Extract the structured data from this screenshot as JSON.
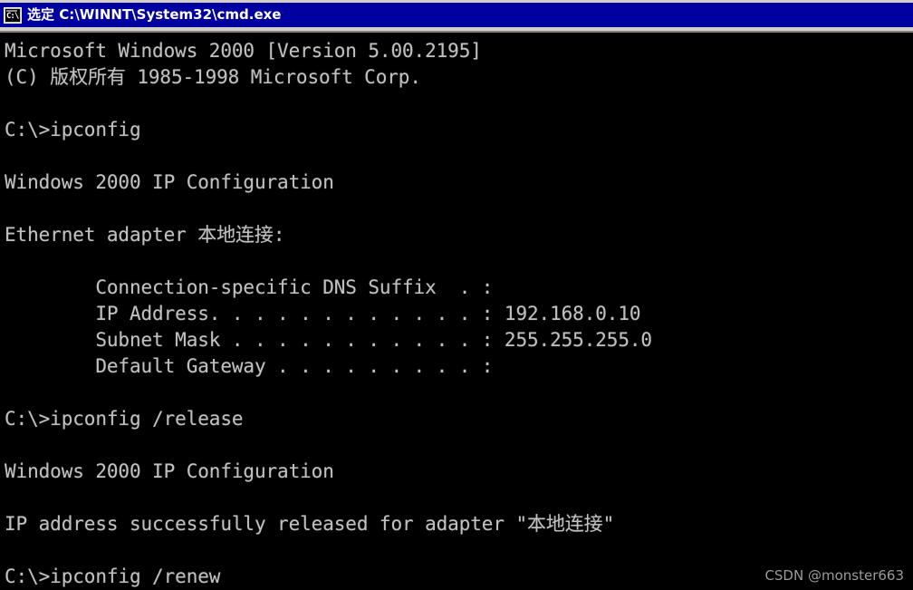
{
  "window": {
    "title_prefix": "选定",
    "title_path": "C:\\WINNT\\System32\\cmd.exe",
    "title_full": "选定 C:\\WINNT\\System32\\cmd.exe",
    "icon": "console-icon",
    "icon_glyph": "C:\\",
    "colors": {
      "titlebar_bg": "#0000a0",
      "titlebar_text": "#ffffff",
      "console_bg": "#000000",
      "console_text": "#c0c0c0",
      "frame": "#d4d0c8",
      "watermark_text": "#9a9a9a"
    }
  },
  "console": {
    "lines": [
      "Microsoft Windows 2000 [Version 5.00.2195]",
      "(C) 版权所有 1985-1998 Microsoft Corp.",
      "",
      "C:\\>ipconfig",
      "",
      "Windows 2000 IP Configuration",
      "",
      "Ethernet adapter 本地连接:",
      "",
      "        Connection-specific DNS Suffix  . :",
      "        IP Address. . . . . . . . . . . . : 192.168.0.10",
      "        Subnet Mask . . . . . . . . . . . : 255.255.255.0",
      "        Default Gateway . . . . . . . . . :",
      "",
      "C:\\>ipconfig /release",
      "",
      "Windows 2000 IP Configuration",
      "",
      "IP address successfully released for adapter \"本地连接\"",
      "",
      "C:\\>ipconfig /renew"
    ],
    "details": {
      "dns_suffix_label": "Connection-specific DNS Suffix",
      "dns_suffix_value": "",
      "ip_address_label": "IP Address",
      "ip_address_value": "192.168.0.10",
      "subnet_mask_label": "Subnet Mask",
      "subnet_mask_value": "255.255.255.0",
      "default_gateway_label": "Default Gateway",
      "default_gateway_value": ""
    },
    "commands": [
      "ipconfig",
      "ipconfig /release",
      "ipconfig /renew"
    ],
    "adapter_name": "本地连接",
    "os_banner": "Microsoft Windows 2000 [Version 5.00.2195]",
    "copyright": "(C) 版权所有 1985-1998 Microsoft Corp."
  },
  "watermark": {
    "text": "CSDN @monster663"
  }
}
